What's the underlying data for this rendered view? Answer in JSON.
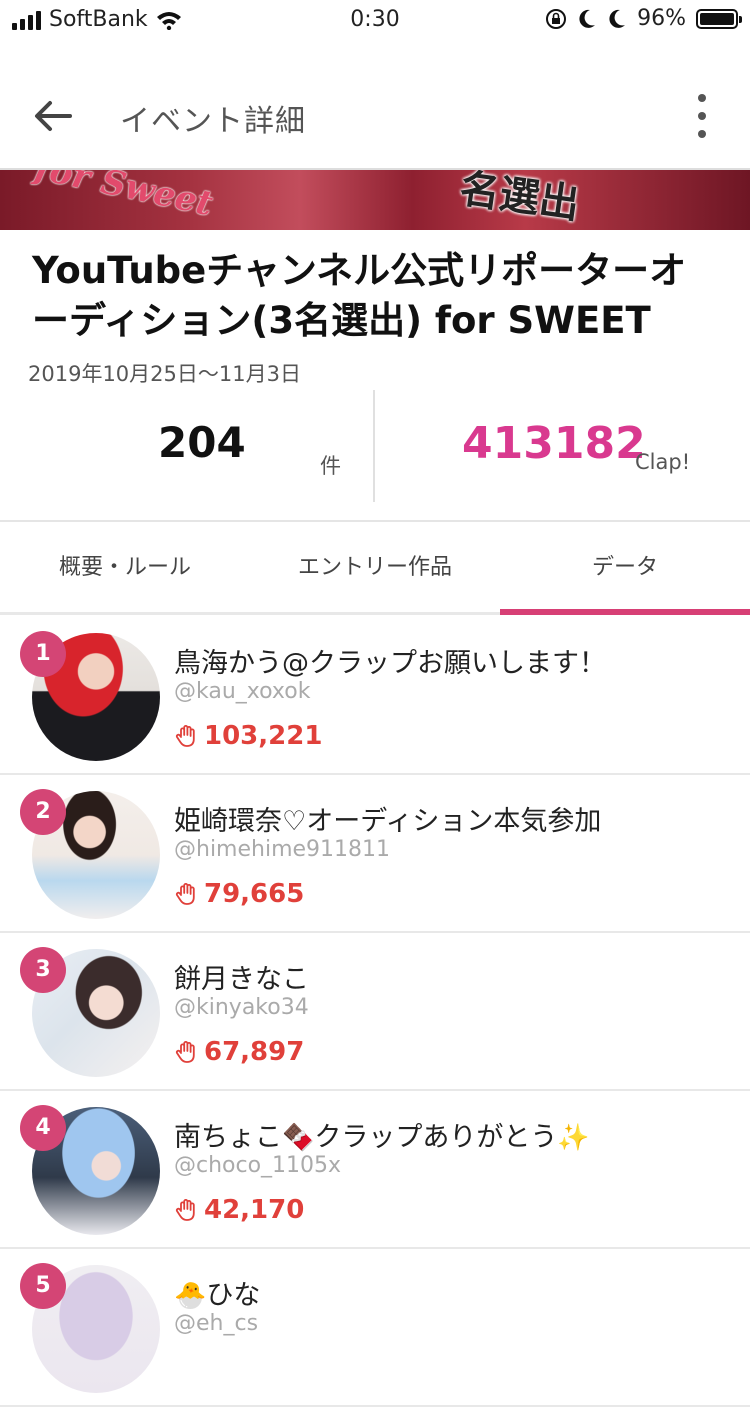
{
  "status_bar": {
    "carrier": "SoftBank",
    "time": "0:30",
    "battery": "96%"
  },
  "app_bar": {
    "title": "イベント詳細"
  },
  "banner": {
    "script_text": "for Sweet",
    "headline": "名選出"
  },
  "event": {
    "title": "YouTubeチャンネル公式リポーターオーディション(3名選出) for SWEET",
    "date": "2019年10月25日〜11月3日",
    "entry_count": "204",
    "entry_unit": "件",
    "clap_total": "413182",
    "clap_unit": "Clap!"
  },
  "tabs": [
    {
      "label": "概要・ルール"
    },
    {
      "label": "エントリー作品"
    },
    {
      "label": "データ",
      "active": true
    }
  ],
  "ranking": [
    {
      "rank": "1",
      "name": "鳥海かう@クラップお願いします！",
      "handle": "@kau_xoxok",
      "claps": "103,221"
    },
    {
      "rank": "2",
      "name": "姫崎環奈♡オーディション本気参加",
      "handle": "@himehime911811",
      "claps": "79,665"
    },
    {
      "rank": "3",
      "name": "餅月きなこ",
      "handle": "@kinyako34",
      "claps": "67,897"
    },
    {
      "rank": "4",
      "name": "南ちょこ",
      "name_emoji": "🍫",
      "name_suffix": "クラップありがとう",
      "name_emoji2": "✨",
      "handle": "@choco_1105x",
      "claps": "42,170"
    },
    {
      "rank": "5",
      "name_emoji": "🐣",
      "name": "ひな",
      "handle": "@eh_cs"
    }
  ],
  "colors": {
    "accent": "#d73f75",
    "clap_total": "#d9398f",
    "clap_count": "#e0403a"
  }
}
